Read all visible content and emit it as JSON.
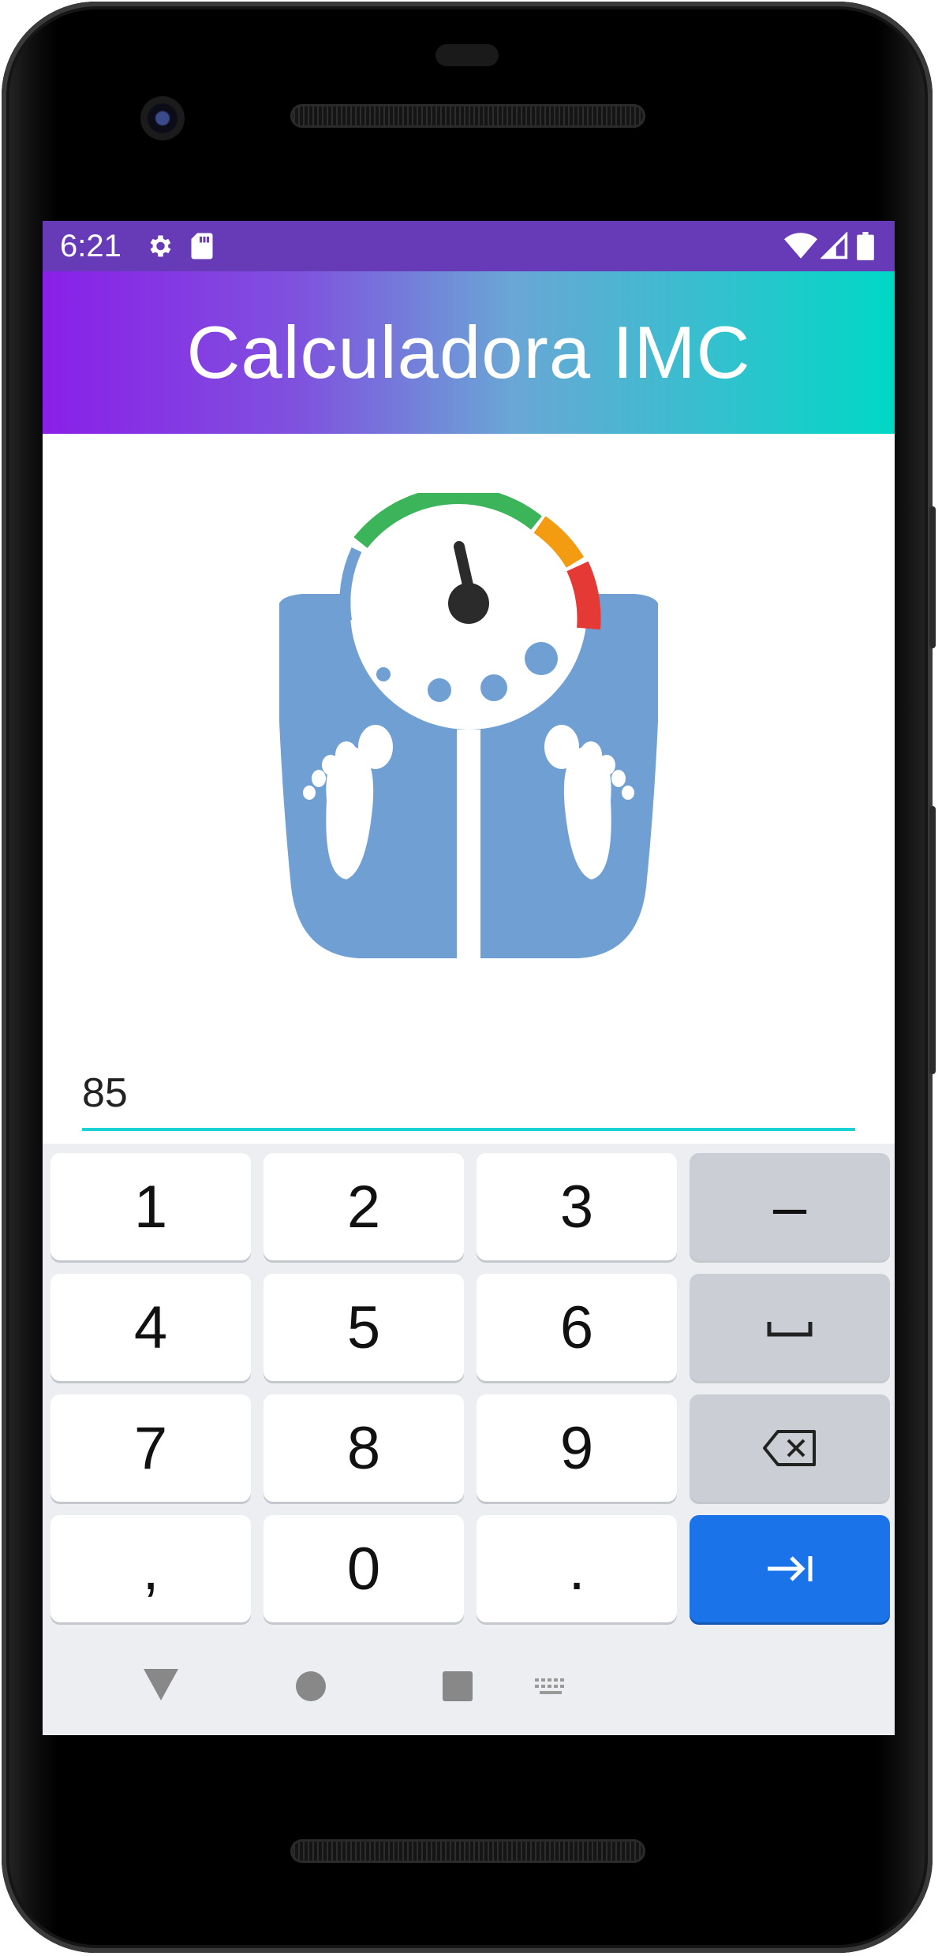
{
  "status_bar": {
    "time": "6:21",
    "icons": [
      "settings-icon",
      "sd-card-icon",
      "wifi-icon",
      "signal-icon",
      "battery-icon"
    ],
    "color": "#673ab7"
  },
  "app_bar": {
    "title": "Calculadora IMC",
    "gradient": [
      "#8a1fe8",
      "#00d8c6"
    ]
  },
  "illustration": {
    "name": "bathroom-scale-icon",
    "colors": {
      "body": "#6f9fd3",
      "gauge_green": "#3cb55a",
      "gauge_orange": "#f39c12",
      "gauge_red": "#e53935"
    }
  },
  "input": {
    "value": "85",
    "underline_color": "#19d3d3"
  },
  "keyboard": {
    "rows": [
      [
        "1",
        "2",
        "3",
        "–"
      ],
      [
        "4",
        "5",
        "6",
        "space"
      ],
      [
        "7",
        "8",
        "9",
        "backspace"
      ],
      [
        ",",
        "0",
        ".",
        "next"
      ]
    ],
    "enter_color": "#1a73e8"
  },
  "nav_bar": {
    "buttons": [
      "back-icon",
      "home-icon",
      "recents-icon",
      "keyboard-switch-icon"
    ]
  }
}
